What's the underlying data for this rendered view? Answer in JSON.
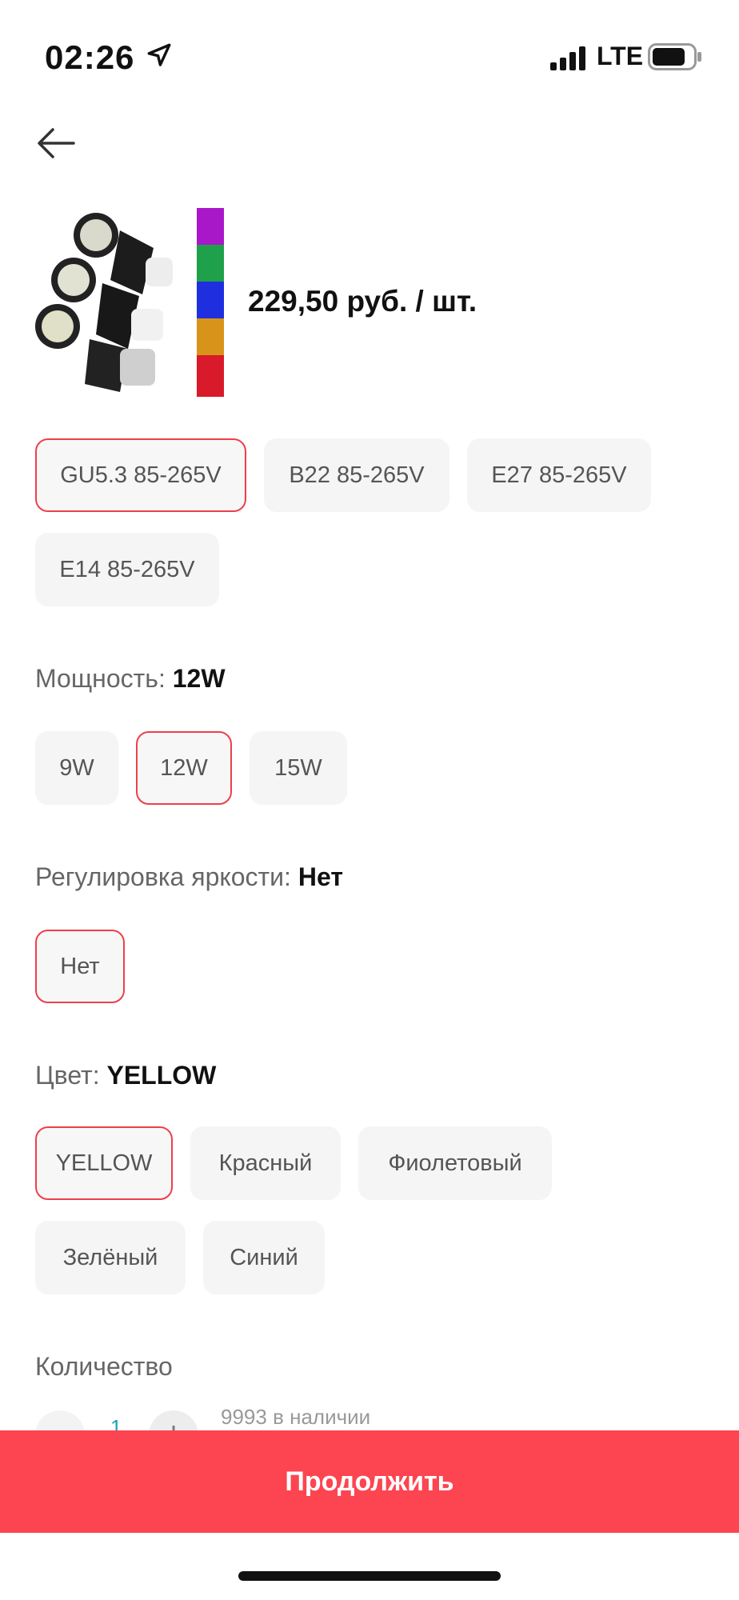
{
  "status_bar": {
    "time": "02:26",
    "network": "LTE",
    "icons": [
      "location-arrow-icon",
      "signal-bars-icon",
      "battery-icon"
    ]
  },
  "header": {
    "back_icon": "arrow-left-icon"
  },
  "product": {
    "price": "229,50 руб. / шт.",
    "image": "led-bulbs-with-color-strip"
  },
  "socket_options": [
    {
      "label": "GU5.3 85-265V",
      "selected": true
    },
    {
      "label": "B22 85-265V",
      "selected": false
    },
    {
      "label": "E27 85-265V",
      "selected": false
    },
    {
      "label": "E14 85-265V",
      "selected": false
    }
  ],
  "power": {
    "label": "Мощность:",
    "value": "12W",
    "options": [
      {
        "label": "9W",
        "selected": false
      },
      {
        "label": "12W",
        "selected": true
      },
      {
        "label": "15W",
        "selected": false
      }
    ]
  },
  "dimming": {
    "label": "Регулировка яркости:",
    "value": "Нет",
    "options": [
      {
        "label": "Нет",
        "selected": true
      }
    ]
  },
  "color": {
    "label": "Цвет:",
    "value": "YELLOW",
    "options": [
      {
        "label": "YELLOW",
        "selected": true
      },
      {
        "label": "Красный",
        "selected": false
      },
      {
        "label": "Фиолетовый",
        "selected": false
      },
      {
        "label": "Зелёный",
        "selected": false
      },
      {
        "label": "Синий",
        "selected": false
      }
    ]
  },
  "quantity": {
    "label": "Количество",
    "value": "1",
    "stock": "9993 в наличии"
  },
  "footer": {
    "continue_label": "Продолжить"
  },
  "colors": {
    "accent": "#fc4550",
    "selected_border": "#ee3f4a",
    "chip_bg": "#f5f5f5",
    "qty_value": "#1aa3b8"
  }
}
